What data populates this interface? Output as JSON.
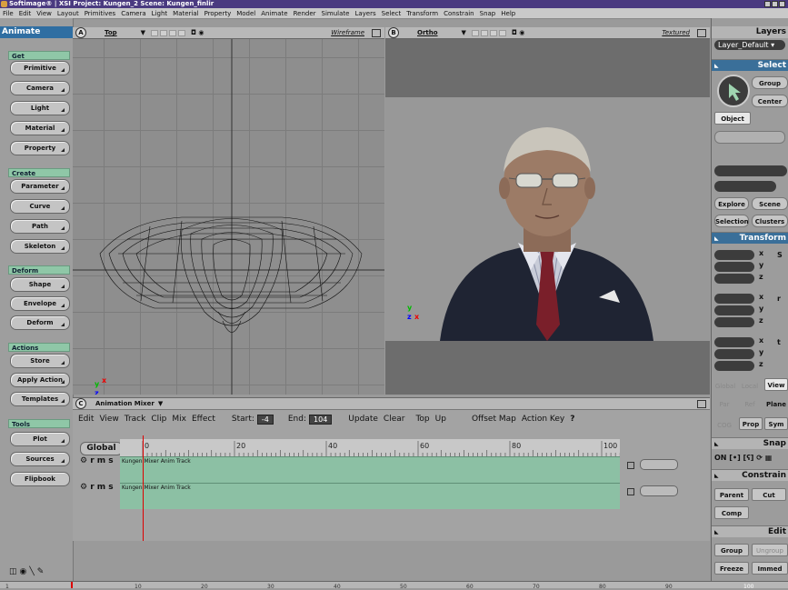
{
  "window": {
    "title": "Softimage® | XSI Project: Kungen_2    Scene: Kungen_finlir"
  },
  "menu": [
    "File",
    "Edit",
    "View",
    "Layout",
    "Primitives",
    "Camera",
    "Light",
    "Material",
    "Property",
    "Model",
    "Animate",
    "Render",
    "Simulate",
    "Layers",
    "Select",
    "Transform",
    "Constrain",
    "Snap",
    "Help"
  ],
  "left": {
    "mode": "Animate",
    "sections": {
      "get": "Get",
      "create": "Create",
      "deform": "Deform",
      "actions": "Actions",
      "tools": "Tools"
    },
    "get_buttons": [
      "Primitive",
      "Camera",
      "Light",
      "Material",
      "Property"
    ],
    "create_buttons": [
      "Parameter",
      "Curve",
      "Path",
      "Skeleton"
    ],
    "deform_buttons": [
      "Shape",
      "Envelope",
      "Deform"
    ],
    "actions_buttons": [
      "Store",
      "Apply Action",
      "Templates"
    ],
    "tools_buttons": [
      "Plot",
      "Sources",
      "Flipbook"
    ]
  },
  "viewportA": {
    "letter": "A",
    "name": "Top",
    "mode": "Wireframe"
  },
  "viewportB": {
    "letter": "B",
    "name": "Ortho",
    "mode": "Textured"
  },
  "mixer": {
    "letter": "C",
    "title": "Animation Mixer",
    "menus": [
      "Edit",
      "View",
      "Track",
      "Clip",
      "Mix",
      "Effect"
    ],
    "start_label": "Start:",
    "start": "-4",
    "end_label": "End:",
    "end": "104",
    "buttons": [
      "Update",
      "Clear",
      "Top",
      "Up",
      "Offset Map",
      "Action Key",
      "?"
    ],
    "global": "Global",
    "ruler": [
      "0",
      "20",
      "40",
      "60",
      "80",
      "100"
    ],
    "tracks": [
      {
        "flags": "r m s",
        "label": "Kungen Mixer Anim Track"
      },
      {
        "flags": "r m s",
        "label": "Kungen Mixer Anim Track"
      }
    ]
  },
  "right": {
    "layers": "Layers",
    "layer_value": "Layer_Default",
    "select": "Select",
    "group": "Group",
    "center": "Center",
    "object": "Object",
    "explore": "Explore",
    "scene": "Scene",
    "selection": "Selection",
    "clusters": "Clusters",
    "transform": "Transform",
    "global": "Global",
    "local": "Local",
    "view": "View",
    "par": "Par",
    "ref": "Ref",
    "plane": "Plane",
    "cog": "COG",
    "prop": "Prop",
    "sym": "Sym",
    "snap": "Snap",
    "on": "ON",
    "constrain": "Constrain",
    "parent": "Parent",
    "cut": "Cut",
    "comp": "Comp",
    "edit": "Edit",
    "group2": "Group",
    "ungroup": "Ungroup",
    "freeze": "Freeze",
    "immed": "Immed"
  },
  "timeline": {
    "ticks": [
      "1",
      "10",
      "20",
      "30",
      "40",
      "50",
      "60",
      "70",
      "80",
      "90"
    ],
    "end": "100"
  },
  "colors": {
    "title_bar": "#4a3a80",
    "mode_header": "#2f6ea2",
    "section": "#8fc7a7",
    "track": "#8cc0a4",
    "playhead": "#dd0000"
  }
}
